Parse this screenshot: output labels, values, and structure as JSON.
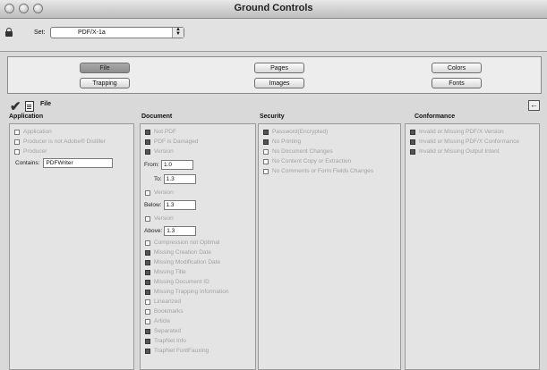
{
  "window": {
    "title": "Ground Controls"
  },
  "setbar": {
    "label": "Set:",
    "selected": "PDF/X-1a"
  },
  "nav": {
    "buttons": [
      "File",
      "Trapping",
      "Pages",
      "Images",
      "Colors",
      "Fonts"
    ]
  },
  "section": {
    "label": "File"
  },
  "columns": {
    "application": {
      "header": "Application",
      "items": [
        {
          "label": "Application",
          "checked": false
        },
        {
          "label": "Producer is not Adobe® Distiller",
          "checked": false
        },
        {
          "label": "Producer",
          "checked": false
        }
      ],
      "contains_label": "Contains:",
      "contains_value": "PDFWriter"
    },
    "document": {
      "header": "Document",
      "items_top": [
        {
          "label": "Not PDF",
          "checked": true
        },
        {
          "label": "PDF is Damaged",
          "checked": true
        },
        {
          "label": "Version",
          "checked": true
        }
      ],
      "from_label": "From:",
      "from_value": "1.0",
      "to_label": "To:",
      "to_value": "1.3",
      "version2_label": "Version",
      "below_label": "Below:",
      "below_value": "1.3",
      "version3_label": "Version",
      "above_label": "Above:",
      "above_value": "1.3",
      "items_bottom": [
        {
          "label": "Compression not Optimal",
          "checked": false
        },
        {
          "label": "Missing Creation Date",
          "checked": true
        },
        {
          "label": "Missing Modification Date",
          "checked": true
        },
        {
          "label": "Missing Title",
          "checked": true
        },
        {
          "label": "Missing Document ID",
          "checked": true
        },
        {
          "label": "Missing Trapping Information",
          "checked": true
        },
        {
          "label": "Linearized",
          "checked": false
        },
        {
          "label": "Bookmarks",
          "checked": false
        },
        {
          "label": "Article",
          "checked": false
        },
        {
          "label": "Separated",
          "checked": true
        },
        {
          "label": "TrapNet Info",
          "checked": true
        },
        {
          "label": "TrapNet FontFauxing",
          "checked": true
        }
      ]
    },
    "security": {
      "header": "Security",
      "items": [
        {
          "label": "Password(Encrypted)",
          "checked": true
        },
        {
          "label": "No Printing",
          "checked": true
        },
        {
          "label": "No Document Changes",
          "checked": false
        },
        {
          "label": "No Content Copy or Extraction",
          "checked": false
        },
        {
          "label": "No Comments or Form Fields Changes",
          "checked": false
        }
      ]
    },
    "conformance": {
      "header": "Conformance",
      "items": [
        {
          "label": "Invalid or Missing PDF/X Version",
          "checked": true
        },
        {
          "label": "Invalid or Missing PDF/X Conformance",
          "checked": true
        },
        {
          "label": "Invalid or Missing Output Intent",
          "checked": true
        }
      ]
    }
  }
}
